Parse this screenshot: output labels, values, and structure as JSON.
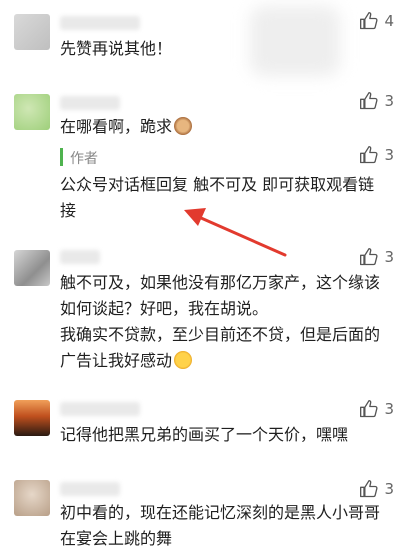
{
  "comments": [
    {
      "text": "先赞再说其他！",
      "likes": "4"
    },
    {
      "text": "在哪看啊，跪求",
      "likes": "3",
      "reply": {
        "tag": "作者",
        "likes": "3",
        "text": "公众号对话框回复 触不可及 即可获取观看链接"
      }
    },
    {
      "text": "触不可及，如果他没有那亿万家产，这个缘该如何谈起？好吧，我在胡说。",
      "text2": "我确实不贷款，至少目前还不贷，但是后面的广告让我好感动",
      "likes": "3"
    },
    {
      "text": "记得他把黑兄弟的画买了一个天价，嘿嘿",
      "likes": "3"
    },
    {
      "text": "初中看的，现在还能记忆深刻的是黑人小哥哥在宴会上跳的舞",
      "likes": "3"
    }
  ],
  "icons": {
    "like": "thumbs-up-icon",
    "see_no_evil_emoji": "monkey-emoji",
    "laugh_emoji": "laughing-emoji"
  },
  "colors": {
    "author_bar": "#4fb34f",
    "arrow": "#e23a2e"
  }
}
